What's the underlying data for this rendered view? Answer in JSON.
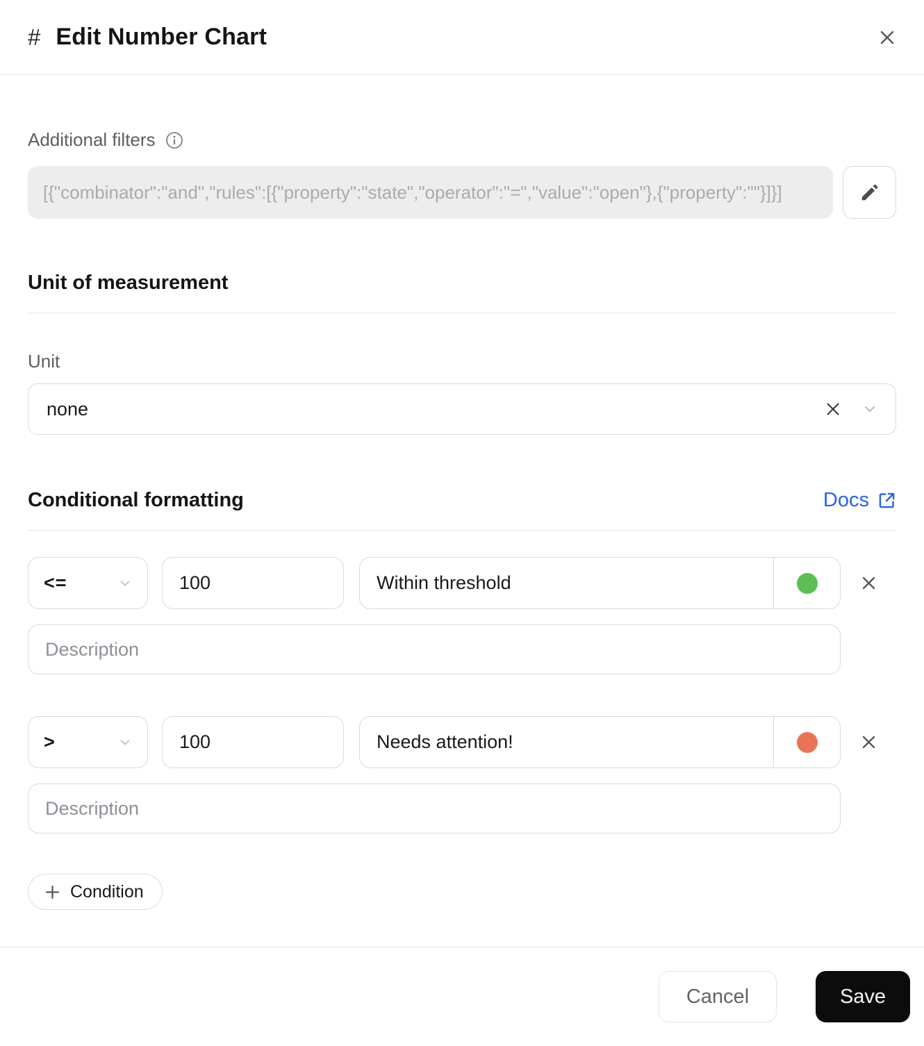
{
  "header": {
    "hash": "#",
    "title": "Edit Number Chart"
  },
  "filters": {
    "label": "Additional filters",
    "value": "[{\"combinator\":\"and\",\"rules\":[{\"property\":\"state\",\"operator\":\"=\",\"value\":\"open\"},{\"property\":\"\"}]}]"
  },
  "unit_section": {
    "title": "Unit of measurement",
    "field_label": "Unit",
    "selected_value": "none"
  },
  "conditional": {
    "title": "Conditional formatting",
    "docs_link": "Docs",
    "add_button": "Condition",
    "conditions": [
      {
        "operator": "<=",
        "value": "100",
        "label": "Within threshold",
        "color": "#5cbe55",
        "description_placeholder": "Description"
      },
      {
        "operator": ">",
        "value": "100",
        "label": "Needs attention!",
        "color": "#ea7357",
        "description_placeholder": "Description"
      }
    ]
  },
  "footer": {
    "cancel": "Cancel",
    "save": "Save"
  },
  "colors": {
    "docs_blue": "#2b63e0",
    "green_status": "#5cbe55",
    "orange_status": "#ea7357"
  }
}
